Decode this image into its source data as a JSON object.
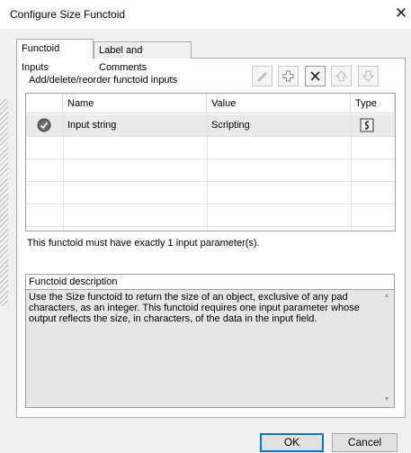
{
  "window": {
    "title": "Configure Size Functoid"
  },
  "tabs": [
    {
      "label": "Functoid Inputs",
      "active": true
    },
    {
      "label": "Label and Comments",
      "active": false
    }
  ],
  "inputs_section": {
    "label": "Add/delete/reorder functoid inputs",
    "toolbar": [
      {
        "name": "edit-icon",
        "enabled": false
      },
      {
        "name": "add-icon",
        "enabled": true
      },
      {
        "name": "delete-icon",
        "enabled": true
      },
      {
        "name": "move-up-icon",
        "enabled": false
      },
      {
        "name": "move-down-icon",
        "enabled": false
      }
    ]
  },
  "grid": {
    "columns": [
      "Name",
      "Value",
      "Type"
    ],
    "rows": [
      {
        "status_icon": "check-icon",
        "name": "Input string",
        "value": "Scripting",
        "type_icon": "scripting-icon"
      }
    ]
  },
  "param_note": "This functoid must have exactly 1 input parameter(s).",
  "description": {
    "label": "Functoid description",
    "text": "Use the Size functoid to return the size of an object, exclusive of any pad characters, as an integer. This functoid requires one input parameter whose output reflects the size, in characters, of the data in the input field."
  },
  "buttons": {
    "ok": "OK",
    "cancel": "Cancel"
  },
  "colors": {
    "accent": "#0078d7",
    "selected_row": "#eaeaea",
    "dialog_bg": "#f0f0f0"
  }
}
